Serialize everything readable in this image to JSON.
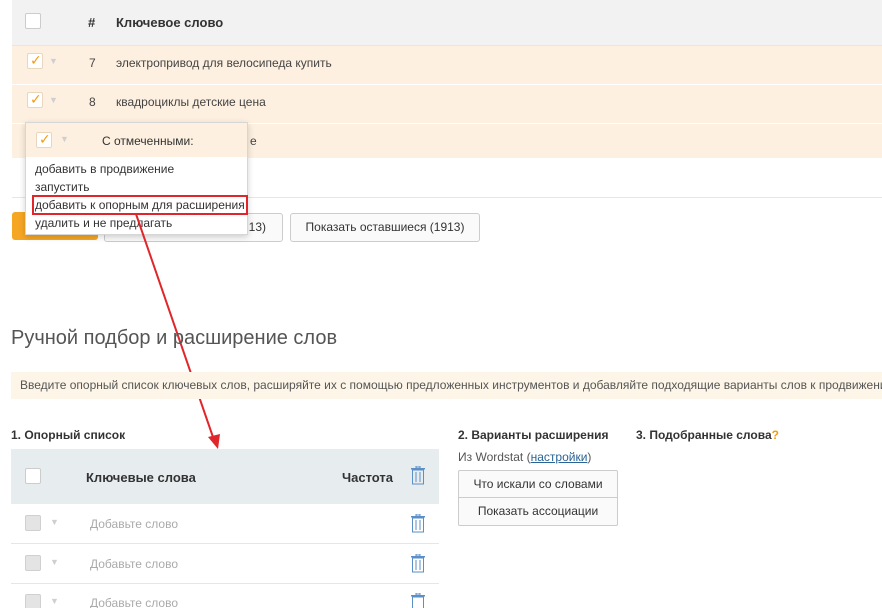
{
  "keywords_table": {
    "header": {
      "num": "#",
      "keyword": "Ключевое слово"
    },
    "rows": [
      {
        "num": "7",
        "keyword": "электропривод для велосипеда купить",
        "checked": true
      },
      {
        "num": "8",
        "keyword": "квадроциклы детские цена",
        "checked": true
      },
      {
        "num": "",
        "keyword": "е",
        "checked": true
      }
    ]
  },
  "popup": {
    "title": "С отмеченными:",
    "items": [
      "добавить в продвижение",
      "запустить",
      "добавить к опорным для расширения",
      "удалить и не предлагать"
    ],
    "highlight_color": "#e0262a"
  },
  "buttons": {
    "show_partial_tail": "13)",
    "show_rest": "Показать оставшиеся (1913)"
  },
  "manual": {
    "title": "Ручной подбор и расширение слов",
    "info": "Введите опорный список ключевых слов, расширяйте их с помощью предложенных инструментов и добавляйте подходящие варианты слов к продвижению",
    "col1_title": "1. Опорный список",
    "col2_title": "2. Варианты расширения",
    "col3_title": "3. Подобранные слова",
    "col3_q": "?",
    "source_prefix": "Из Wordstat (",
    "source_link": "настройки",
    "source_suffix": ")",
    "btn_searched": "Что искали со словами",
    "btn_assoc": "Показать ассоциации",
    "ref_header": {
      "keywords": "Ключевые слова",
      "freq": "Частота"
    },
    "ref_rows": [
      {
        "placeholder": "Добавьте слово"
      },
      {
        "placeholder": "Добавьте слово"
      },
      {
        "placeholder": "Добавьте слово"
      }
    ]
  },
  "colors": {
    "accent": "#f5a623",
    "row_highlight": "#fdf0e0",
    "arrow": "#e0262a"
  }
}
